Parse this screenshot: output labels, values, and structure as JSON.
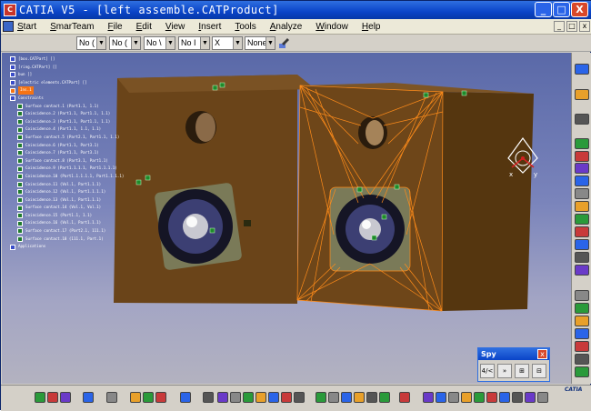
{
  "window": {
    "title": "CATIA V5 - [left assemble.CATProduct]",
    "min": "_",
    "max": "□",
    "close": "X"
  },
  "menu": [
    "Start",
    "SmarTeam",
    "File",
    "Edit",
    "View",
    "Insert",
    "Tools",
    "Analyze",
    "Window",
    "Help"
  ],
  "doc_controls": [
    "_",
    "□",
    "x"
  ],
  "toolbar": {
    "combos": [
      "No (",
      "No (",
      "No \\",
      "No I",
      "X",
      "None"
    ]
  },
  "tree": {
    "nodes": [
      {
        "label": "[box.CATPart] []",
        "type": "part"
      },
      {
        "label": "[ring.CATPart] []",
        "type": "part"
      },
      {
        "label": "bun []",
        "type": "part"
      },
      {
        "label": "[electric elements.CATPart] []",
        "type": "part"
      },
      {
        "label": "Ins.1",
        "type": "part",
        "highlight": true
      },
      {
        "label": "Constraints",
        "type": "folder"
      },
      {
        "label": "Surface contact.1 (Part1.1, 1.1)",
        "type": "c"
      },
      {
        "label": "Coincidence.2 (Part1.1, Part1.1, 1.1)",
        "type": "c"
      },
      {
        "label": "Coincidence.3 (Part1.1, Part1.1, 1.1)",
        "type": "c"
      },
      {
        "label": "Coincidence.4 (Part1.1, 1.1, 1.1)",
        "type": "c"
      },
      {
        "label": "Surface contact.5 (Part2.1, Part1.1, 1.1)",
        "type": "c"
      },
      {
        "label": "Coincidence.6 (Part1.1, Part3.1)",
        "type": "c"
      },
      {
        "label": "Coincidence.7 (Part1.1, Part3.1)",
        "type": "c"
      },
      {
        "label": "Surface contact.8 (Part3.1, Part1.1)",
        "type": "c"
      },
      {
        "label": "Coincidence.9 (Part1.1.1.1, Part1.1.1.1)",
        "type": "c"
      },
      {
        "label": "Coincidence.10 (Part1.1.1.1.1, Part1.1.1.1)",
        "type": "c"
      },
      {
        "label": "Coincidence.11 (Vol.1, Part1.1.1)",
        "type": "c"
      },
      {
        "label": "Coincidence.12 (Vol.1, Part1.1.1.1)",
        "type": "c"
      },
      {
        "label": "Coincidence.13 (Vol.1, Part1.1.1)",
        "type": "c"
      },
      {
        "label": "Surface contact.14 (Vol.1, Vol.1)",
        "type": "c"
      },
      {
        "label": "Coincidence.15 (Part1.1, 1.1)",
        "type": "c"
      },
      {
        "label": "Coincidence.16 (Vol.1, Part1.1.1)",
        "type": "c"
      },
      {
        "label": "Surface contact.17 (Part2.1, 111.1)",
        "type": "c"
      },
      {
        "label": "Surface contact.18 (111.1, Part.1)",
        "type": "c"
      },
      {
        "label": "Applications",
        "type": "folder"
      }
    ]
  },
  "spy": {
    "title": "Spy",
    "close": "x",
    "tools": [
      "4/<",
      "»",
      "⊞",
      "⊟"
    ]
  },
  "compass": {
    "x": "x",
    "y": "y"
  },
  "logo": "CATIA",
  "colors": {
    "box": "#6b4518",
    "wire": "#ff8c1a",
    "speaker": "#1a1a2e",
    "accent": "#0a44c8"
  }
}
